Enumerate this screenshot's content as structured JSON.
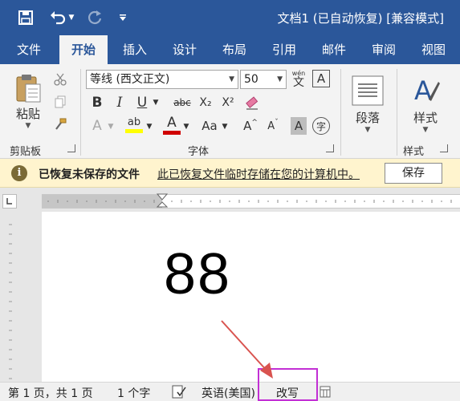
{
  "titlebar": {
    "doc_title": "文档1 (已自动恢复) [兼容模式]",
    "qat_icons": [
      "save-icon",
      "undo-icon",
      "redo-icon",
      "customize-icon"
    ]
  },
  "tabs": [
    "文件",
    "开始",
    "插入",
    "设计",
    "布局",
    "引用",
    "邮件",
    "审阅",
    "视图"
  ],
  "active_tab": "开始",
  "ribbon": {
    "clipboard": {
      "paste_label": "粘贴",
      "group_label": "剪贴板"
    },
    "font": {
      "font_name": "等线 (西文正文)",
      "font_size": "50",
      "wen_label": "wén",
      "wen_char": "文",
      "a_box": "A",
      "bold": "B",
      "italic": "I",
      "underline": "U",
      "strike": "abc",
      "subscript": "X₂",
      "superscript": "X²",
      "text_effects": "A",
      "highlight": "ab",
      "font_color": "A",
      "case": "Aa",
      "grow": "A",
      "shrink": "A",
      "shading": "A",
      "enclose": "字",
      "group_label": "字体"
    },
    "paragraph": {
      "label": "段落"
    },
    "styles": {
      "label": "样式",
      "group_label": "样式"
    }
  },
  "infobar": {
    "icon": "i",
    "bold_text": "已恢复未保存的文件",
    "message": "此已恢复文件临时存储在您的计算机中。",
    "save_label": "保存"
  },
  "document": {
    "text": "88"
  },
  "status": {
    "page": "第 1 页，共 1 页",
    "words": "1 个字",
    "language": "英语(美国)",
    "mode": "改写"
  },
  "colors": {
    "brand": "#2b579a",
    "highlight": "#ffff00",
    "font_color": "#d00000",
    "annotation": "#c22fd4",
    "arrow": "#d9534f"
  }
}
